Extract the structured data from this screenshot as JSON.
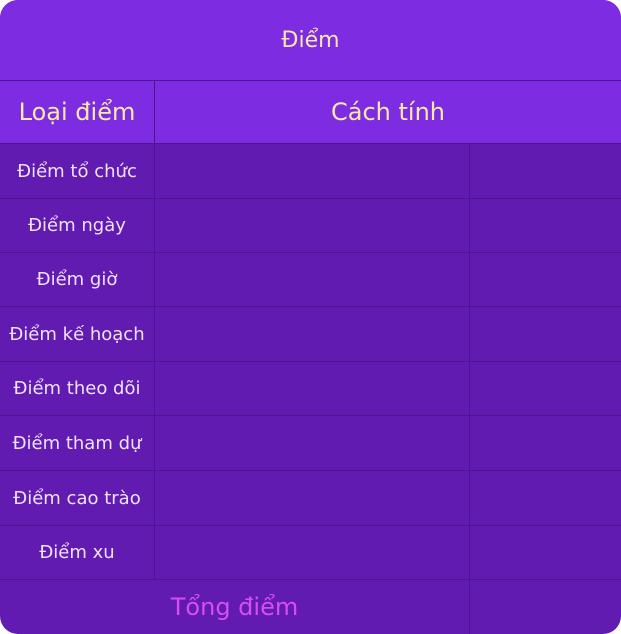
{
  "title": "Điểm",
  "headers": {
    "type": "Loại điểm",
    "method": "Cách tính"
  },
  "rows": [
    {
      "label": "Điểm tổ chức",
      "method": "",
      "value": ""
    },
    {
      "label": "Điểm ngày",
      "method": "",
      "value": ""
    },
    {
      "label": "Điểm giờ",
      "method": "",
      "value": ""
    },
    {
      "label": "Điểm kế hoạch",
      "method": "",
      "value": ""
    },
    {
      "label": "Điểm theo dõi",
      "method": "",
      "value": ""
    },
    {
      "label": "Điểm tham dự",
      "method": "",
      "value": ""
    },
    {
      "label": "Điểm cao trào",
      "method": "",
      "value": ""
    },
    {
      "label": "Điểm xu",
      "method": "",
      "value": ""
    }
  ],
  "total": {
    "label": "Tổng điểm",
    "value": ""
  },
  "colors": {
    "header_bg": "#7d2ce1",
    "body_bg": "#611bb0",
    "header_text": "#f6e8a6",
    "label_text": "#efe2ff",
    "total_text": "#d84df0",
    "grid_line": "#4e1593"
  }
}
